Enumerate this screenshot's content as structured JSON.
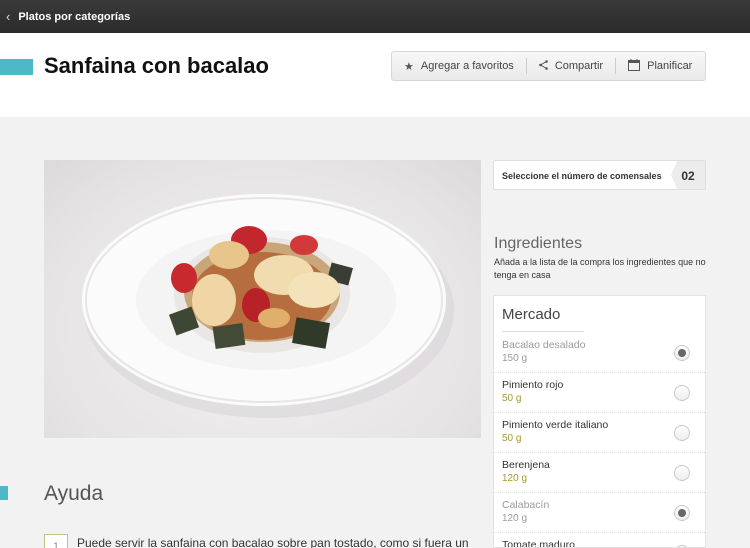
{
  "nav": {
    "back_icon": "chevron-left-icon",
    "title": "Platos por categorías"
  },
  "recipe": {
    "title": "Sanfaina con bacalao"
  },
  "actions": [
    {
      "icon": "star-icon",
      "glyph": "★",
      "label": "Agregar a favoritos"
    },
    {
      "icon": "share-icon",
      "glyph": "<",
      "label": "Compartir"
    },
    {
      "icon": "calendar-icon",
      "glyph": "▦",
      "label": "Planificar"
    }
  ],
  "servings": {
    "label": "Seleccione el número de comensales",
    "count": "02"
  },
  "ingredients": {
    "title": "Ingredientes",
    "subtitle": "Añada a la lista de la compra los ingredientes que no tenga en casa",
    "section": "Mercado",
    "items": [
      {
        "name": "Bacalao desalado",
        "qty": "150 g",
        "selected": true
      },
      {
        "name": "Pimiento rojo",
        "qty": "50 g",
        "selected": false
      },
      {
        "name": "Pimiento verde italiano",
        "qty": "50 g",
        "selected": false
      },
      {
        "name": "Berenjena",
        "qty": "120 g",
        "selected": false
      },
      {
        "name": "Calabacín",
        "qty": "120 g",
        "selected": true
      },
      {
        "name": "Tomate maduro",
        "qty": "",
        "selected": false
      }
    ]
  },
  "help": {
    "title": "Ayuda",
    "tip_number": "1",
    "tip_text": "Puede servir la sanfaina con bacalao sobre pan tostado, como si fuera un"
  },
  "colors": {
    "accent": "#4fb8c8",
    "quantity": "#a39a2a",
    "topbar": "#2f2f2f"
  }
}
